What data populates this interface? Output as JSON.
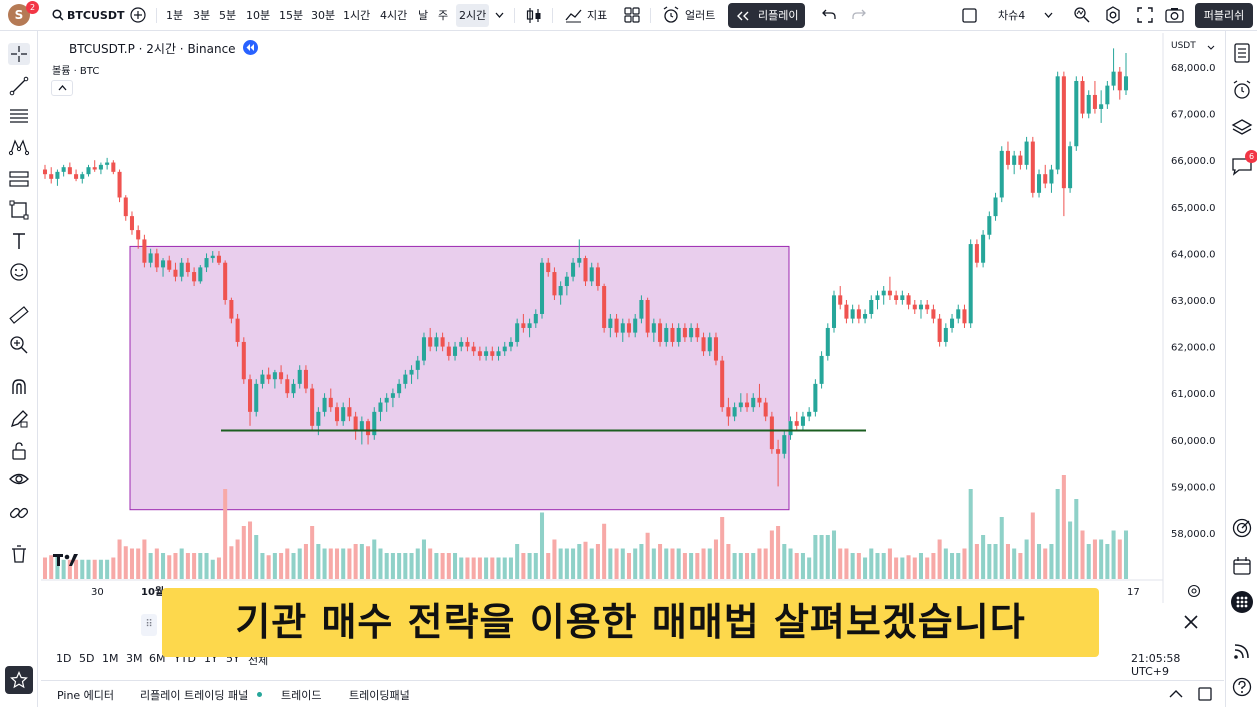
{
  "topbar": {
    "avatar_letter": "S",
    "avatar_badge": "2",
    "symbol": "BTCUSDT",
    "intervals": [
      "1분",
      "3분",
      "5분",
      "10분",
      "15분",
      "30분",
      "1시간",
      "4시간",
      "날",
      "주",
      "2시간"
    ],
    "selected_interval": "2시간",
    "indicators_label": "지표",
    "alerts_label": "얼러트",
    "replay_label": "리플레이",
    "layout_label": "차슈4",
    "publish_label": "퍼블리쉬"
  },
  "legend": {
    "title": "BTCUSDT.P · 2시간 · Binance",
    "volume": "볼륨 · BTC"
  },
  "price_axis": {
    "currency": "USDT",
    "ticks": [
      "68,000.0",
      "67,000.0",
      "66,000.0",
      "65,000.0",
      "64,000.0",
      "63,000.0",
      "62,000.0",
      "61,000.0",
      "60,000.0",
      "59,000.0",
      "58,000.0"
    ]
  },
  "time_axis": {
    "labels": [
      "30",
      "10월",
      "17"
    ]
  },
  "range_bar": {
    "ranges": [
      "1D",
      "5D",
      "1M",
      "3M",
      "6M",
      "YTD",
      "1Y",
      "5Y",
      "전체"
    ],
    "clock": "21:05:58 UTC+9"
  },
  "bottom_tabs": [
    "Pine 에디터",
    "리플레이 트레이딩 패널",
    "트레이드",
    "트레이딩패널"
  ],
  "caption": "기관 매수 전략을 이용한 매매법 살펴보겠습니다",
  "right_badge": "6",
  "colors": {
    "up": "#26a69a",
    "down": "#ef5350",
    "up_volume": "#8fd1c8",
    "down_volume": "#f7a9a7",
    "box_fill": "#e1bee7",
    "box_border": "#9c27b0",
    "support_line": "#1b5e20",
    "caption_bg": "#fdd84c"
  },
  "chart_data": {
    "type": "candlestick",
    "symbol": "BTCUSDT.P",
    "interval": "2h",
    "ylim": [
      57500,
      68400
    ],
    "support_level": 60200,
    "zone": {
      "high": 64150,
      "low": 58500
    },
    "candles": [
      [
        65800,
        65900,
        65600,
        65700
      ],
      [
        65700,
        65850,
        65500,
        65600
      ],
      [
        65600,
        65800,
        65450,
        65750
      ],
      [
        65750,
        65900,
        65650,
        65850
      ],
      [
        65850,
        65950,
        65700,
        65700
      ],
      [
        65700,
        65800,
        65550,
        65600
      ],
      [
        65600,
        65750,
        65500,
        65700
      ],
      [
        65700,
        65900,
        65650,
        65850
      ],
      [
        65850,
        66000,
        65750,
        65800
      ],
      [
        65800,
        65950,
        65700,
        65900
      ],
      [
        65900,
        66050,
        65800,
        65950
      ],
      [
        65950,
        66000,
        65700,
        65750
      ],
      [
        65750,
        65800,
        65100,
        65200
      ],
      [
        65200,
        65250,
        64700,
        64800
      ],
      [
        64800,
        64900,
        64400,
        64500
      ],
      [
        64500,
        64600,
        64100,
        64300
      ],
      [
        64300,
        64400,
        63700,
        63800
      ],
      [
        63800,
        64100,
        63700,
        64000
      ],
      [
        64000,
        64100,
        63600,
        63700
      ],
      [
        63700,
        63900,
        63500,
        63850
      ],
      [
        63850,
        63950,
        63600,
        63650
      ],
      [
        63650,
        63800,
        63400,
        63500
      ],
      [
        63500,
        63900,
        63400,
        63800
      ],
      [
        63800,
        63900,
        63500,
        63600
      ],
      [
        63600,
        63700,
        63300,
        63400
      ],
      [
        63400,
        63750,
        63350,
        63700
      ],
      [
        63700,
        64000,
        63600,
        63900
      ],
      [
        63900,
        64050,
        63800,
        63950
      ],
      [
        63950,
        64050,
        63750,
        63800
      ],
      [
        63800,
        63850,
        62900,
        63000
      ],
      [
        63000,
        63050,
        62500,
        62600
      ],
      [
        62600,
        62700,
        62000,
        62100
      ],
      [
        62100,
        62200,
        61200,
        61300
      ],
      [
        61300,
        61400,
        60300,
        60600
      ],
      [
        60600,
        61300,
        60500,
        61200
      ],
      [
        61200,
        61500,
        61100,
        61400
      ],
      [
        61400,
        61550,
        61200,
        61300
      ],
      [
        61300,
        61500,
        61100,
        61450
      ],
      [
        61450,
        61600,
        61200,
        61300
      ],
      [
        61300,
        61400,
        60900,
        61000
      ],
      [
        61000,
        61300,
        60900,
        61200
      ],
      [
        61200,
        61600,
        61100,
        61500
      ],
      [
        61500,
        61600,
        61000,
        61100
      ],
      [
        61100,
        61200,
        60200,
        60300
      ],
      [
        60300,
        60700,
        60100,
        60600
      ],
      [
        60600,
        61000,
        60500,
        60900
      ],
      [
        60900,
        61100,
        60600,
        60700
      ],
      [
        60700,
        60800,
        60300,
        60400
      ],
      [
        60400,
        60800,
        60300,
        60700
      ],
      [
        60700,
        60900,
        60400,
        60500
      ],
      [
        60500,
        60600,
        60000,
        60200
      ],
      [
        60200,
        60500,
        59900,
        60400
      ],
      [
        60400,
        60450,
        59900,
        60100
      ],
      [
        60100,
        60700,
        60000,
        60600
      ],
      [
        60600,
        60900,
        60400,
        60800
      ],
      [
        60800,
        61000,
        60600,
        60900
      ],
      [
        60900,
        61100,
        60700,
        61000
      ],
      [
        61000,
        61300,
        60900,
        61200
      ],
      [
        61200,
        61500,
        61100,
        61400
      ],
      [
        61400,
        61600,
        61200,
        61500
      ],
      [
        61500,
        61800,
        61300,
        61700
      ],
      [
        61700,
        62300,
        61600,
        62200
      ],
      [
        62200,
        62400,
        61900,
        62000
      ],
      [
        62000,
        62300,
        61900,
        62200
      ],
      [
        62200,
        62300,
        61900,
        62000
      ],
      [
        62000,
        62100,
        61700,
        61800
      ],
      [
        61800,
        62100,
        61700,
        62000
      ],
      [
        62000,
        62200,
        61900,
        62100
      ],
      [
        62100,
        62200,
        61900,
        62000
      ],
      [
        62000,
        62100,
        61800,
        61900
      ],
      [
        61900,
        62000,
        61700,
        61800
      ],
      [
        61800,
        62000,
        61700,
        61900
      ],
      [
        61900,
        62000,
        61700,
        61800
      ],
      [
        61800,
        62000,
        61700,
        61900
      ],
      [
        61900,
        62100,
        61800,
        62000
      ],
      [
        62000,
        62200,
        61900,
        62100
      ],
      [
        62100,
        62600,
        62000,
        62500
      ],
      [
        62500,
        62700,
        62300,
        62400
      ],
      [
        62400,
        62600,
        62200,
        62500
      ],
      [
        62500,
        62800,
        62400,
        62700
      ],
      [
        62700,
        63900,
        62600,
        63800
      ],
      [
        63800,
        63900,
        63500,
        63600
      ],
      [
        63600,
        63700,
        63000,
        63100
      ],
      [
        63100,
        63400,
        62900,
        63300
      ],
      [
        63300,
        63600,
        63100,
        63500
      ],
      [
        63500,
        63900,
        63400,
        63800
      ],
      [
        63800,
        64300,
        63700,
        63900
      ],
      [
        63900,
        63950,
        63300,
        63400
      ],
      [
        63400,
        63800,
        63300,
        63700
      ],
      [
        63700,
        63800,
        63200,
        63300
      ],
      [
        63300,
        63350,
        62300,
        62400
      ],
      [
        62400,
        62700,
        62200,
        62600
      ],
      [
        62600,
        62700,
        62200,
        62300
      ],
      [
        62300,
        62600,
        62100,
        62500
      ],
      [
        62500,
        62600,
        62200,
        62300
      ],
      [
        62300,
        62700,
        62200,
        62600
      ],
      [
        62600,
        63100,
        62500,
        63000
      ],
      [
        63000,
        63050,
        62200,
        62300
      ],
      [
        62300,
        62600,
        62100,
        62500
      ],
      [
        62500,
        62600,
        62000,
        62100
      ],
      [
        62100,
        62500,
        62000,
        62400
      ],
      [
        62400,
        62500,
        62000,
        62100
      ],
      [
        62100,
        62500,
        62000,
        62400
      ],
      [
        62400,
        62500,
        62100,
        62200
      ],
      [
        62200,
        62500,
        62100,
        62400
      ],
      [
        62400,
        62500,
        62100,
        62200
      ],
      [
        62200,
        62300,
        61800,
        61900
      ],
      [
        61900,
        62300,
        61800,
        62200
      ],
      [
        62200,
        62300,
        61600,
        61700
      ],
      [
        61700,
        61800,
        60600,
        60700
      ],
      [
        60700,
        60900,
        60300,
        60500
      ],
      [
        60500,
        60800,
        60400,
        60700
      ],
      [
        60700,
        61000,
        60600,
        60800
      ],
      [
        60800,
        61000,
        60600,
        60700
      ],
      [
        60700,
        61000,
        60600,
        60900
      ],
      [
        60900,
        61200,
        60700,
        60800
      ],
      [
        60800,
        60900,
        60400,
        60500
      ],
      [
        60500,
        60600,
        59700,
        59800
      ],
      [
        59800,
        60000,
        59000,
        59700
      ],
      [
        59700,
        60200,
        59600,
        60100
      ],
      [
        60100,
        60500,
        60000,
        60400
      ],
      [
        60400,
        60600,
        60200,
        60300
      ],
      [
        60300,
        60600,
        60200,
        60500
      ],
      [
        60500,
        60700,
        60400,
        60600
      ],
      [
        60600,
        61300,
        60500,
        61200
      ],
      [
        61200,
        61900,
        61100,
        61800
      ],
      [
        61800,
        62500,
        61700,
        62400
      ],
      [
        62400,
        63200,
        62300,
        63100
      ],
      [
        63100,
        63300,
        62800,
        62900
      ],
      [
        62900,
        63000,
        62500,
        62600
      ],
      [
        62600,
        62900,
        62500,
        62800
      ],
      [
        62800,
        62900,
        62500,
        62600
      ],
      [
        62600,
        62800,
        62500,
        62700
      ],
      [
        62700,
        63100,
        62600,
        63000
      ],
      [
        63000,
        63200,
        62800,
        63100
      ],
      [
        63100,
        63300,
        62900,
        63200
      ],
      [
        63200,
        63500,
        63000,
        63100
      ],
      [
        63100,
        63200,
        62900,
        63000
      ],
      [
        63000,
        63200,
        62900,
        63100
      ],
      [
        63100,
        63150,
        62800,
        62900
      ],
      [
        62900,
        63000,
        62700,
        62800
      ],
      [
        62800,
        63000,
        62600,
        62900
      ],
      [
        62900,
        63000,
        62700,
        62800
      ],
      [
        62800,
        62900,
        62500,
        62600
      ],
      [
        62600,
        62700,
        62000,
        62100
      ],
      [
        62100,
        62500,
        62000,
        62400
      ],
      [
        62400,
        62700,
        62300,
        62600
      ],
      [
        62600,
        62900,
        62500,
        62800
      ],
      [
        62800,
        62900,
        62400,
        62500
      ],
      [
        62500,
        64300,
        62400,
        64200
      ],
      [
        64200,
        64300,
        63700,
        63800
      ],
      [
        63800,
        64500,
        63700,
        64400
      ],
      [
        64400,
        64900,
        64300,
        64800
      ],
      [
        64800,
        65300,
        64700,
        65200
      ],
      [
        65200,
        66300,
        65100,
        66200
      ],
      [
        66200,
        66400,
        65800,
        65900
      ],
      [
        65900,
        66200,
        65700,
        66100
      ],
      [
        66100,
        66200,
        65800,
        65900
      ],
      [
        65900,
        66500,
        65800,
        66400
      ],
      [
        66400,
        66500,
        65200,
        65300
      ],
      [
        65300,
        65800,
        65200,
        65700
      ],
      [
        65700,
        65900,
        65400,
        65500
      ],
      [
        65500,
        65900,
        65300,
        65800
      ],
      [
        65800,
        67900,
        65700,
        67800
      ],
      [
        67800,
        67900,
        64800,
        65400
      ],
      [
        65400,
        66400,
        65300,
        66300
      ],
      [
        66300,
        67800,
        66200,
        67700
      ],
      [
        67700,
        67800,
        66900,
        67000
      ],
      [
        67000,
        67500,
        66900,
        67400
      ],
      [
        67400,
        67700,
        67000,
        67100
      ],
      [
        67100,
        67500,
        66800,
        67200
      ],
      [
        67200,
        67700,
        67100,
        67600
      ],
      [
        67600,
        68400,
        67500,
        67900
      ],
      [
        67900,
        68000,
        67300,
        67500
      ],
      [
        67500,
        68300,
        67400,
        67800
      ]
    ],
    "volume_unit": "BTC"
  }
}
